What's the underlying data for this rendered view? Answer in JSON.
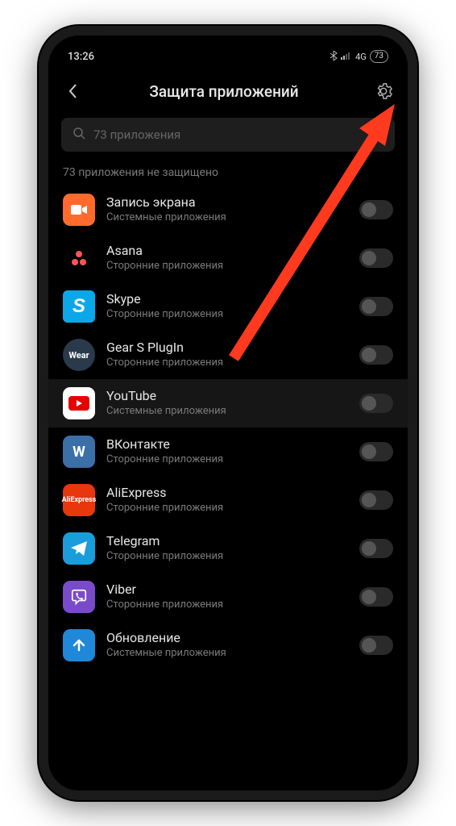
{
  "status": {
    "time": "13:26",
    "network": "4G",
    "battery": "73"
  },
  "header": {
    "title": "Защита приложений"
  },
  "search": {
    "placeholder": "73 приложения"
  },
  "section": {
    "label": "73 приложения не защищено"
  },
  "apps": [
    {
      "name": "Запись экрана",
      "sub": "Системные приложения",
      "iconClass": "ic-rec",
      "iconType": "camera",
      "highlighted": false
    },
    {
      "name": "Asana",
      "sub": "Сторонние приложения",
      "iconClass": "ic-asana",
      "iconType": "asana",
      "highlighted": false
    },
    {
      "name": "Skype",
      "sub": "Сторонние приложения",
      "iconClass": "ic-skype",
      "iconType": "skype",
      "highlighted": false
    },
    {
      "name": "Gear S PlugIn",
      "sub": "Сторонние приложения",
      "iconClass": "ic-gear",
      "iconType": "wear",
      "highlighted": false
    },
    {
      "name": "YouTube",
      "sub": "Системные приложения",
      "iconClass": "ic-youtube",
      "iconType": "youtube",
      "highlighted": true
    },
    {
      "name": "ВКонтакте",
      "sub": "Сторонние приложения",
      "iconClass": "ic-vk",
      "iconType": "vk",
      "highlighted": false
    },
    {
      "name": "AliExpress",
      "sub": "Сторонние приложения",
      "iconClass": "ic-ali",
      "iconType": "ali",
      "highlighted": false
    },
    {
      "name": "Telegram",
      "sub": "Сторонние приложения",
      "iconClass": "ic-tg",
      "iconType": "telegram",
      "highlighted": false
    },
    {
      "name": "Viber",
      "sub": "Сторонние приложения",
      "iconClass": "ic-viber",
      "iconType": "viber",
      "highlighted": false
    },
    {
      "name": "Обновление",
      "sub": "Системные приложения",
      "iconClass": "ic-update",
      "iconType": "update",
      "highlighted": false
    }
  ],
  "iconLabels": {
    "wear": "Wear",
    "skype": "S",
    "vk": "W",
    "ali": "AliExpress"
  },
  "annotation": {
    "arrowColor": "#ff3a1f"
  }
}
